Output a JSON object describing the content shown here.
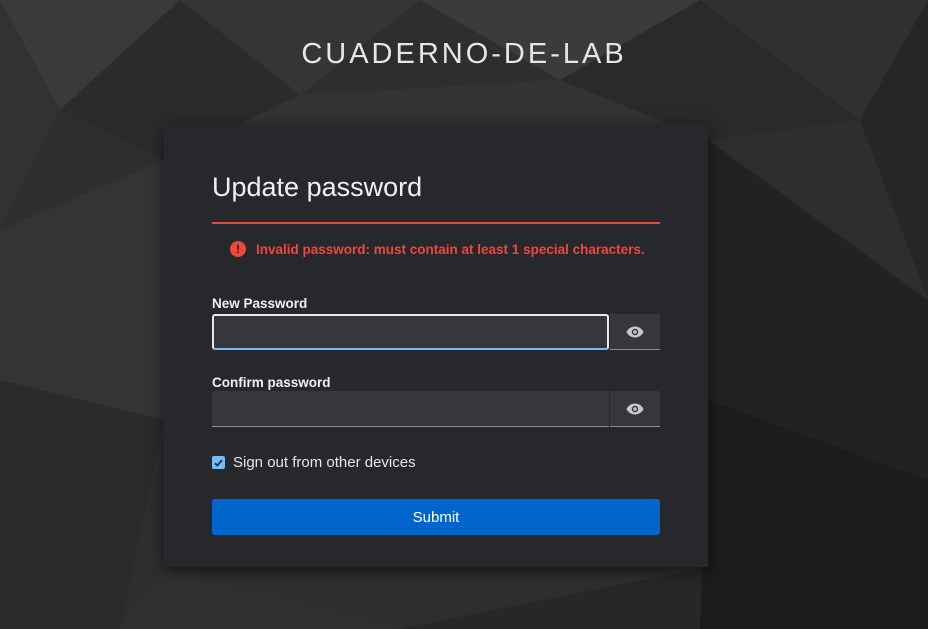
{
  "realm": {
    "title": "CUADERNO-DE-LAB"
  },
  "form": {
    "title": "Update password",
    "alert": {
      "icon": "exclamation-circle-icon",
      "message": "Invalid password: must contain at least 1 special characters.",
      "color": "#f0463c"
    },
    "new_password": {
      "label": "New Password",
      "value": "",
      "toggle_icon": "eye-icon"
    },
    "confirm_password": {
      "label": "Confirm password",
      "value": "",
      "toggle_icon": "eye-icon"
    },
    "logout_sessions": {
      "label": "Sign out from other devices",
      "checked": true
    },
    "submit_label": "Submit"
  },
  "colors": {
    "background": "#2c2c2c",
    "card": "#26282c",
    "accent": "#0066cc",
    "error": "#e8473a",
    "focus": "#73bcf7"
  }
}
